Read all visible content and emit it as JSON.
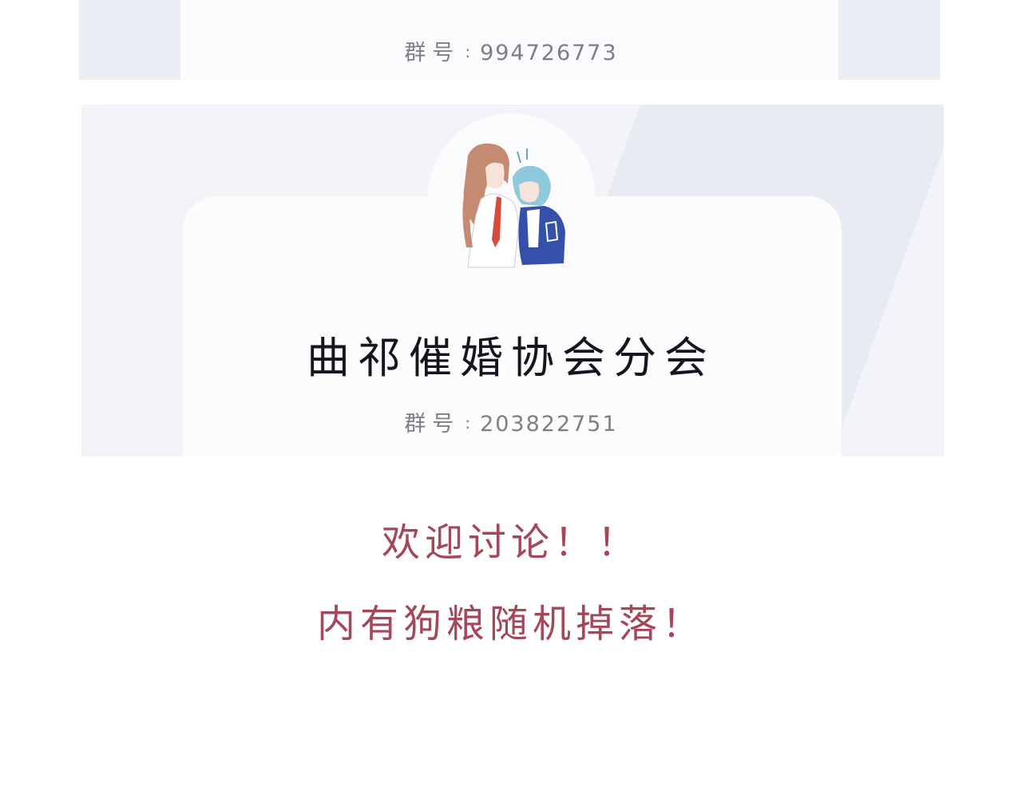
{
  "top_card": {
    "group_label": "群号",
    "separator": ":",
    "group_number": "994726773"
  },
  "main_card": {
    "title": "曲祁催婚协会分会",
    "group_label": "群号",
    "separator": ":",
    "group_number": "203822751"
  },
  "messages": {
    "line1": "欢迎讨论！！",
    "line2": "内有狗粮随机掉落！"
  },
  "colors": {
    "background": "#ffffff",
    "card_backdrop": "#eceef5",
    "card": "#fbfbfd",
    "title": "#15151f",
    "group_number": "#7c7f86",
    "message": "#a54659"
  }
}
